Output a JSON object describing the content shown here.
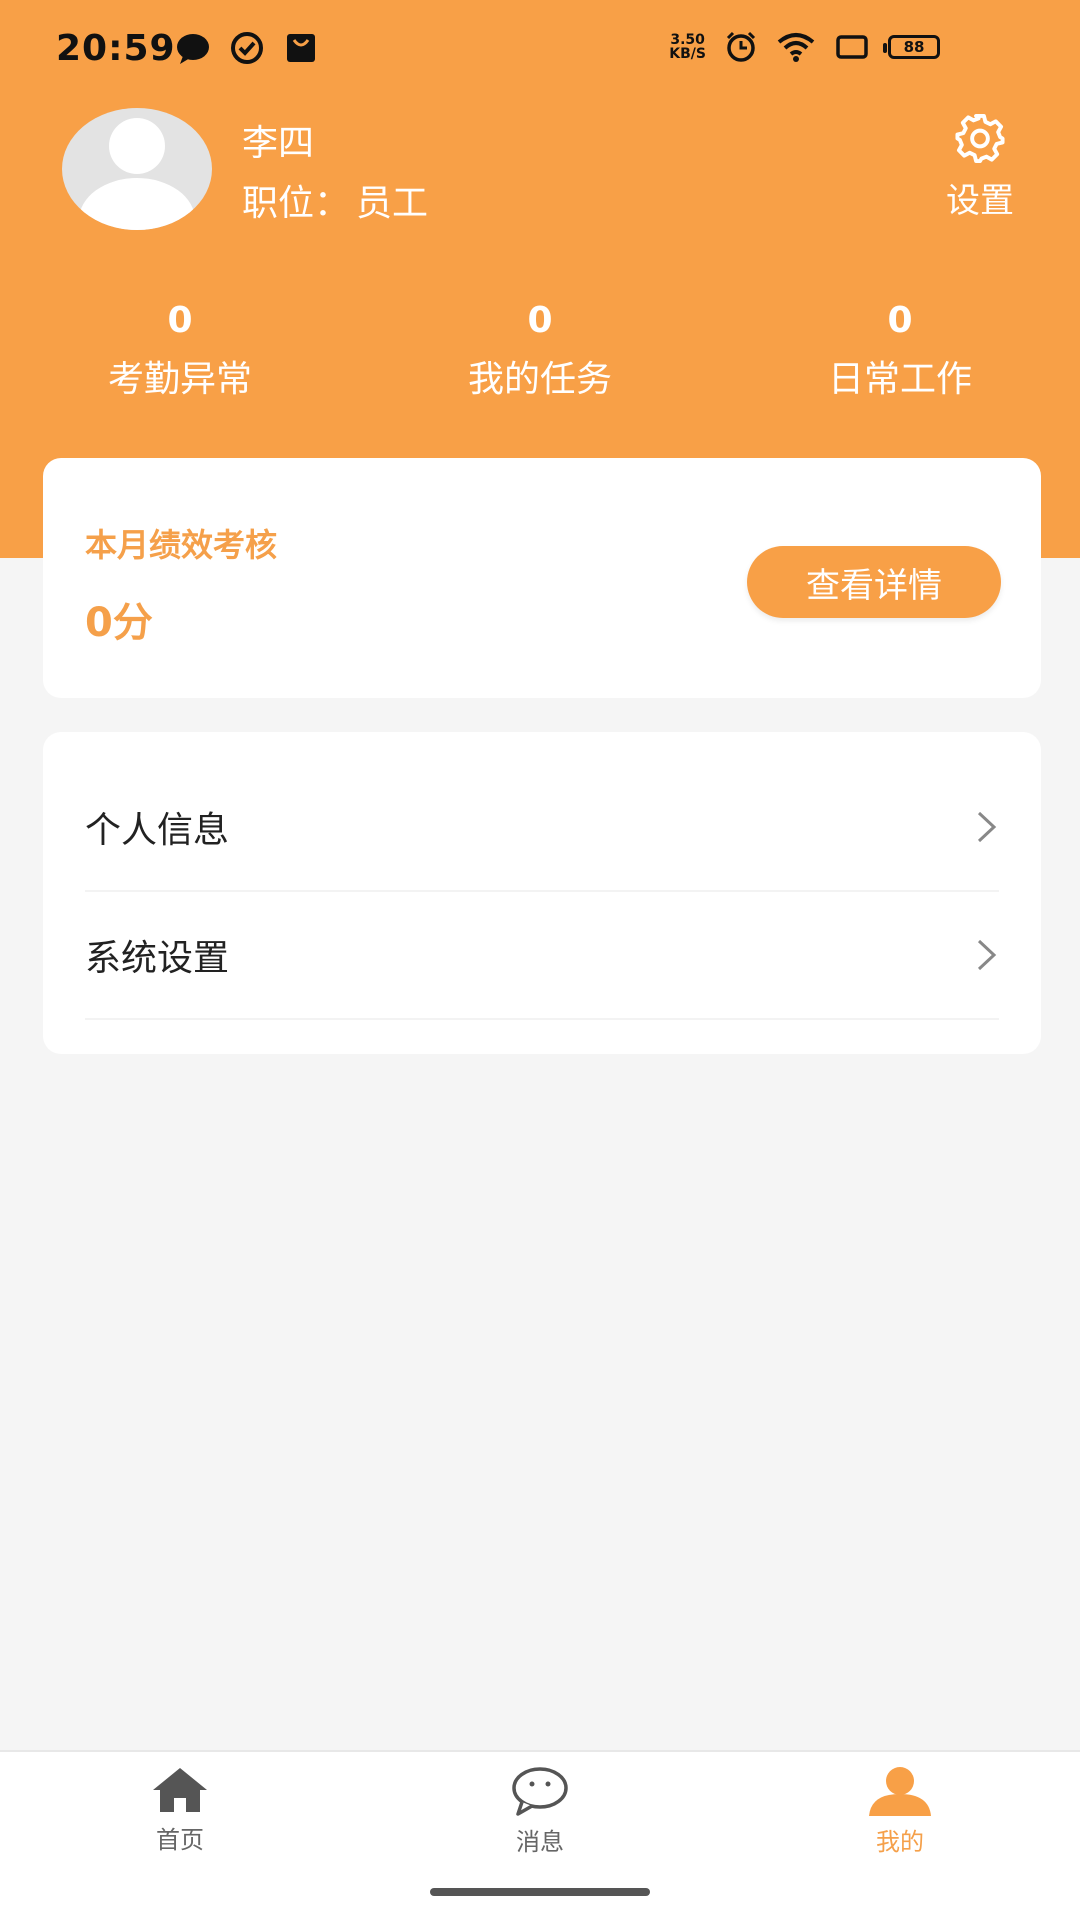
{
  "status_bar": {
    "time": "20:59",
    "net_speed_top": "3.50",
    "net_speed_bottom": "KB/S",
    "battery": "88"
  },
  "profile": {
    "name": "李四",
    "role_label": "职位：",
    "role_value": "员工",
    "settings_label": "设置"
  },
  "stats": [
    {
      "value": "0",
      "label": "考勤异常"
    },
    {
      "value": "0",
      "label": "我的任务"
    },
    {
      "value": "0",
      "label": "日常工作"
    }
  ],
  "performance": {
    "title": "本月绩效考核",
    "score": "0分",
    "button": "查看详情"
  },
  "menu": [
    {
      "label": "个人信息"
    },
    {
      "label": "系统设置"
    }
  ],
  "nav": [
    {
      "label": "首页",
      "icon": "home-icon"
    },
    {
      "label": "消息",
      "icon": "message-icon"
    },
    {
      "label": "我的",
      "icon": "person-icon"
    }
  ],
  "colors": {
    "accent": "#f8a047",
    "accent_text": "#f5a04a",
    "background": "#f5f5f5"
  }
}
